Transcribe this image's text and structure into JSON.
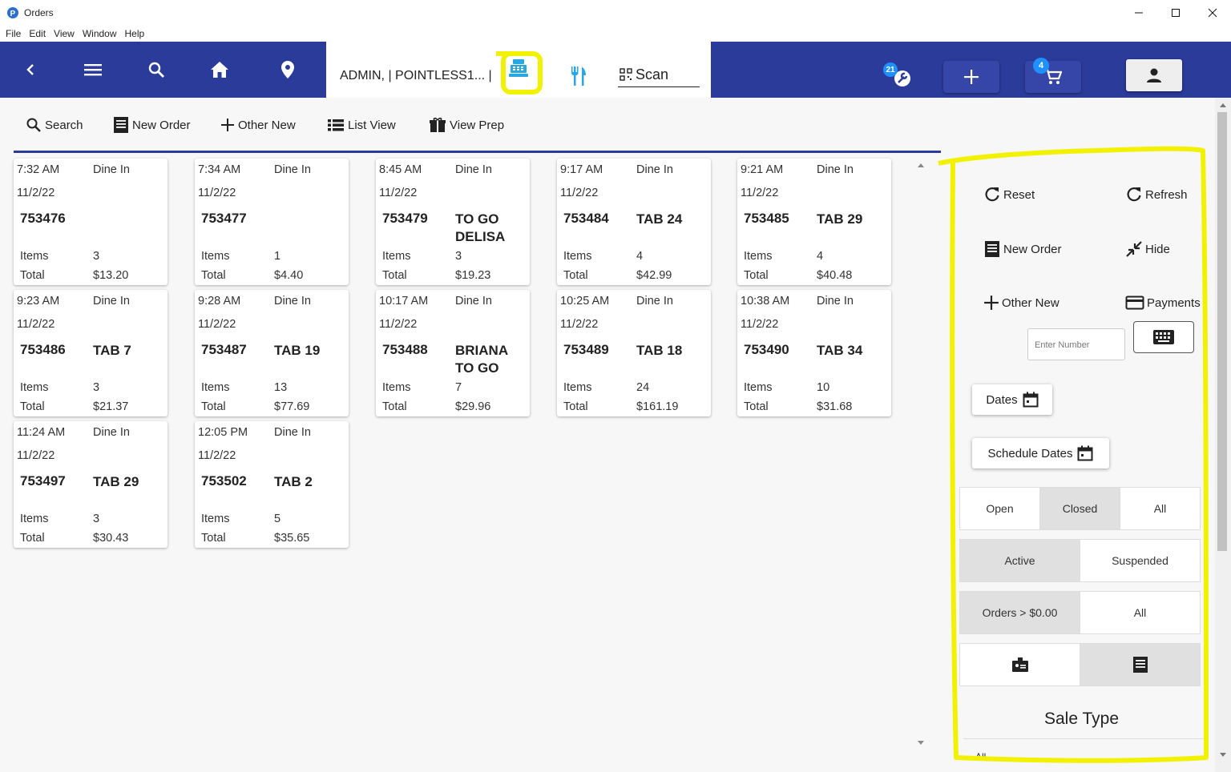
{
  "window": {
    "title": "Orders"
  },
  "menu": [
    "File",
    "Edit",
    "View",
    "Window",
    "Help"
  ],
  "appbar": {
    "user_label": "ADMIN, | POINTLESS1... |",
    "scan_label": "Scan",
    "tools_badge": "21",
    "cart_badge": "4"
  },
  "toolbar": {
    "search": "Search",
    "new_order": "New Order",
    "other_new": "Other New",
    "list_view": "List View",
    "view_prep": "View Prep"
  },
  "orders": [
    {
      "time": "7:32 AM",
      "type": "Dine In",
      "date": "11/2/22",
      "number": "753476",
      "tab": "",
      "items_label": "Items",
      "items": "3",
      "total_label": "Total",
      "total": "$13.20"
    },
    {
      "time": "7:34 AM",
      "type": "Dine In",
      "date": "11/2/22",
      "number": "753477",
      "tab": "",
      "items_label": "Items",
      "items": "1",
      "total_label": "Total",
      "total": "$4.40"
    },
    {
      "time": "8:45 AM",
      "type": "Dine In",
      "date": "11/2/22",
      "number": "753479",
      "tab": "TO GO DELISA",
      "items_label": "Items",
      "items": "3",
      "total_label": "Total",
      "total": "$19.23"
    },
    {
      "time": "9:17 AM",
      "type": "Dine In",
      "date": "11/2/22",
      "number": "753484",
      "tab": "TAB 24",
      "items_label": "Items",
      "items": "4",
      "total_label": "Total",
      "total": "$42.99"
    },
    {
      "time": "9:21 AM",
      "type": "Dine In",
      "date": "11/2/22",
      "number": "753485",
      "tab": "TAB 29",
      "items_label": "Items",
      "items": "4",
      "total_label": "Total",
      "total": "$40.48"
    },
    {
      "time": "9:23 AM",
      "type": "Dine In",
      "date": "11/2/22",
      "number": "753486",
      "tab": "TAB 7",
      "items_label": "Items",
      "items": "3",
      "total_label": "Total",
      "total": "$21.37"
    },
    {
      "time": "9:28 AM",
      "type": "Dine In",
      "date": "11/2/22",
      "number": "753487",
      "tab": "TAB 19",
      "items_label": "Items",
      "items": "13",
      "total_label": "Total",
      "total": "$77.69"
    },
    {
      "time": "10:17 AM",
      "type": "Dine In",
      "date": "11/2/22",
      "number": "753488",
      "tab": "BRIANA TO GO",
      "items_label": "Items",
      "items": "7",
      "total_label": "Total",
      "total": "$29.96"
    },
    {
      "time": "10:25 AM",
      "type": "Dine In",
      "date": "11/2/22",
      "number": "753489",
      "tab": "TAB 18",
      "items_label": "Items",
      "items": "24",
      "total_label": "Total",
      "total": "$161.19"
    },
    {
      "time": "10:38 AM",
      "type": "Dine In",
      "date": "11/2/22",
      "number": "753490",
      "tab": "TAB 34",
      "items_label": "Items",
      "items": "10",
      "total_label": "Total",
      "total": "$31.68"
    },
    {
      "time": "11:24 AM",
      "type": "Dine In",
      "date": "11/2/22",
      "number": "753497",
      "tab": "TAB 29",
      "items_label": "Items",
      "items": "3",
      "total_label": "Total",
      "total": "$30.43"
    },
    {
      "time": "12:05 PM",
      "type": "Dine In",
      "date": "11/2/22",
      "number": "753502",
      "tab": "TAB 2",
      "items_label": "Items",
      "items": "5",
      "total_label": "Total",
      "total": "$35.65"
    }
  ],
  "side": {
    "reset": "Reset",
    "refresh": "Refresh",
    "new_order": "New Order",
    "hide": "Hide",
    "other_new": "Other New",
    "payments": "Payments",
    "enter_number_placeholder": "Enter Number",
    "dates": "Dates",
    "schedule_dates": "Schedule Dates",
    "status": {
      "options": [
        "Open",
        "Closed",
        "All"
      ],
      "selected": "Closed"
    },
    "state": {
      "options": [
        "Active",
        "Suspended"
      ],
      "selected": "Active"
    },
    "amount": {
      "options": [
        "Orders > $0.00",
        "All"
      ],
      "selected": "Orders > $0.00"
    },
    "view_mode_selected": "list-icon",
    "sale_type_title": "Sale Type",
    "sale_type_value": "All"
  },
  "colors": {
    "appbar": "#2b3b9a",
    "highlight": "#f2f200",
    "badge": "#1e90ff",
    "register_icon": "#29a8e0"
  }
}
